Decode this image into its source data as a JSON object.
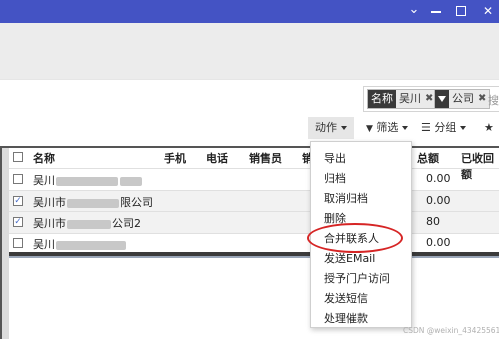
{
  "window": {
    "controls": [
      "chevron-down-icon",
      "minimize-icon",
      "maximize-icon",
      "close-icon"
    ],
    "chevron_glyph": "⌄",
    "close_glyph": "✕",
    "accent": "#4453c4"
  },
  "search": {
    "facets": [
      {
        "label": "名称",
        "value": "吴川",
        "remove": "✖"
      },
      {
        "label": "",
        "value": "公司",
        "remove": "✖",
        "icon": "filter-icon"
      }
    ],
    "input_text": "搜"
  },
  "toolbar": {
    "action_label": "动作",
    "filter_icon": "▼",
    "filter_label": "筛选",
    "group_icon": "☰",
    "group_label": "分组",
    "fav_icon": "★"
  },
  "table": {
    "columns": [
      "名称",
      "手机",
      "电话",
      "销售员",
      "销",
      "总额",
      "已收回额"
    ],
    "rows": [
      {
        "name_pre": "吴川",
        "name_post": "",
        "amount": "0.00",
        "checked": false
      },
      {
        "name_pre": "吴川市",
        "name_post": "限公司",
        "amount": "0.00",
        "checked": true
      },
      {
        "name_pre": "吴川市",
        "name_post": "公司2",
        "amount": "80",
        "checked": true
      },
      {
        "name_pre": "吴川",
        "name_post": "",
        "amount": "0.00",
        "checked": false
      }
    ],
    "check_glyph": "✓"
  },
  "menu": {
    "items": [
      "导出",
      "归档",
      "取消归档",
      "删除",
      "合并联系人",
      "发送EMail",
      "授予门户访问",
      "发送短信",
      "处理催款"
    ],
    "highlighted_index": 4,
    "highlight_color": "#d62525"
  },
  "watermark": "CSDN @weixin_43425561"
}
